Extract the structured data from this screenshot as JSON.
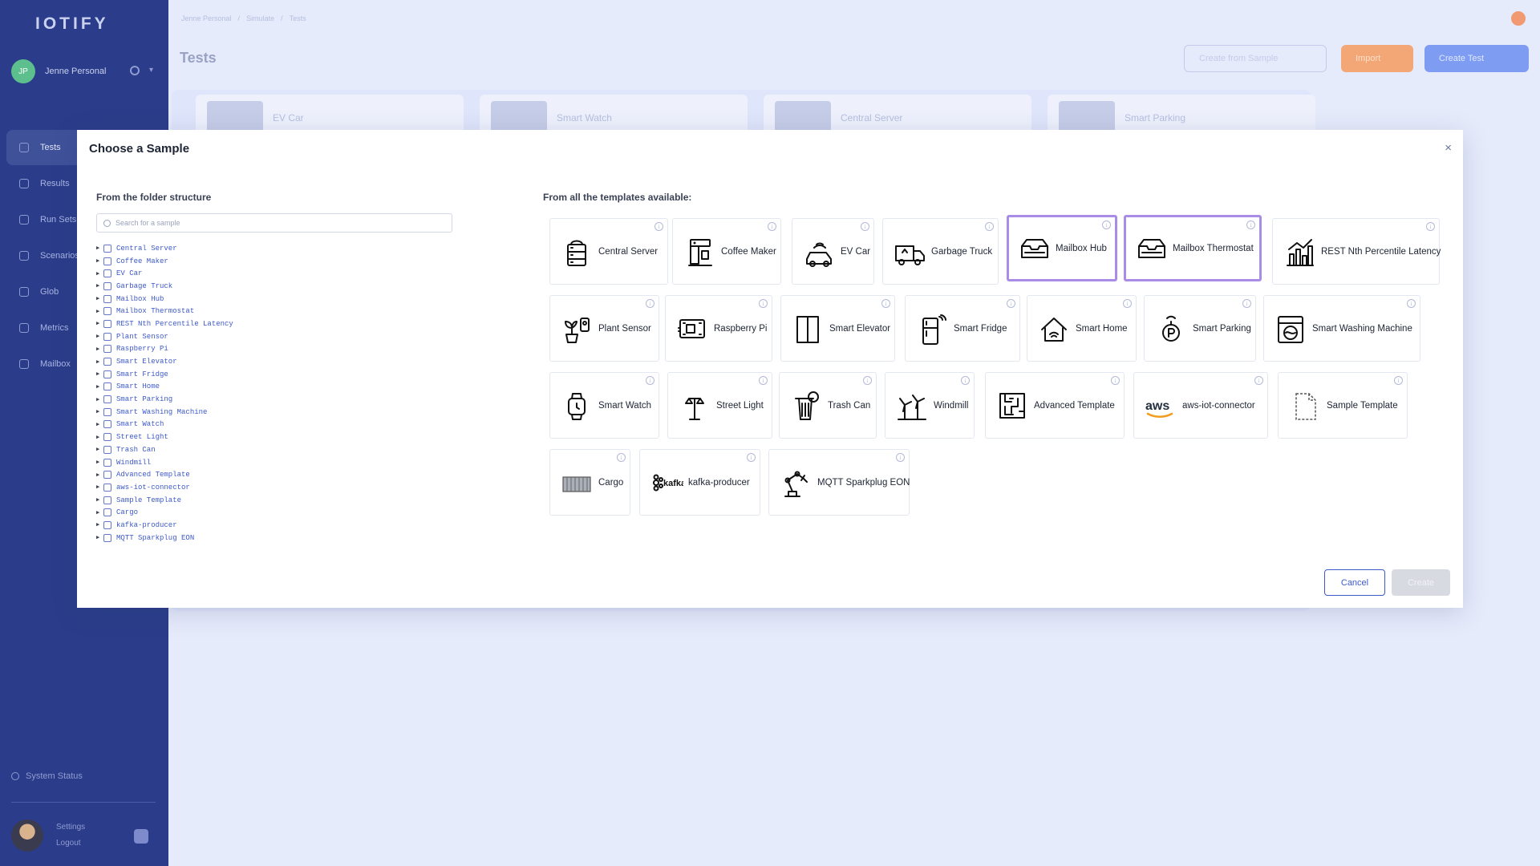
{
  "app": {
    "logo": "IOTIFY",
    "profile_name": "Jenne Personal",
    "profile_initials": "JP"
  },
  "sidebar": {
    "items": [
      {
        "label": "Tests",
        "active": true
      },
      {
        "label": "Results"
      },
      {
        "label": "Run Sets"
      },
      {
        "label": "Scenarios"
      },
      {
        "label": "Glob"
      },
      {
        "label": "Metrics"
      },
      {
        "label": "Mailbox"
      }
    ],
    "system_status": "System Status",
    "settings": "Settings",
    "logout": "Logout"
  },
  "header": {
    "breadcrumb": [
      "Jenne Personal",
      "Simulate",
      "Tests"
    ],
    "title": "Tests",
    "buttons": {
      "from_sample": "Create from Sample",
      "import": "Import",
      "create_test": "Create Test"
    }
  },
  "bg_cards": [
    "EV Car",
    "Smart Watch",
    "Central Server",
    "Smart Parking"
  ],
  "modal": {
    "title": "Choose a Sample",
    "close": "×",
    "left_label": "From the folder structure",
    "search_placeholder": "Search for a sample",
    "right_label": "From all the templates available:",
    "cancel": "Cancel",
    "create": "Create"
  },
  "tree": [
    "Central Server",
    "Coffee Maker",
    "EV Car",
    "Garbage Truck",
    "Mailbox Hub",
    "Mailbox Thermostat",
    "REST Nth Percentile Latency",
    "Plant Sensor",
    "Raspberry Pi",
    "Smart Elevator",
    "Smart Fridge",
    "Smart Home",
    "Smart Parking",
    "Smart Washing Machine",
    "Smart Watch",
    "Street Light",
    "Trash Can",
    "Windmill",
    "Advanced Template",
    "aws-iot-connector",
    "Sample Template",
    "Cargo",
    "kafka-producer",
    "MQTT Sparkplug EON"
  ],
  "templates": [
    {
      "name": "Central Server",
      "icon": "server-icon"
    },
    {
      "name": "Coffee Maker",
      "icon": "coffee-maker-icon"
    },
    {
      "name": "EV Car",
      "icon": "ev-car-icon"
    },
    {
      "name": "Garbage Truck",
      "icon": "garbage-truck-icon"
    },
    {
      "name": "Mailbox Hub",
      "icon": "mailbox-icon",
      "selected": true
    },
    {
      "name": "Mailbox Thermostat",
      "icon": "mailbox-icon",
      "selected": true
    },
    {
      "name": "REST Nth Percentile Latency",
      "icon": "bar-chart-icon"
    },
    {
      "name": "Plant Sensor",
      "icon": "plant-sensor-icon"
    },
    {
      "name": "Raspberry Pi",
      "icon": "circuit-board-icon"
    },
    {
      "name": "Smart Elevator",
      "icon": "elevator-icon"
    },
    {
      "name": "Smart Fridge",
      "icon": "fridge-icon"
    },
    {
      "name": "Smart Home",
      "icon": "home-icon"
    },
    {
      "name": "Smart Parking",
      "icon": "parking-icon"
    },
    {
      "name": "Smart Washing Machine",
      "icon": "washing-machine-icon"
    },
    {
      "name": "Smart Watch",
      "icon": "watch-icon"
    },
    {
      "name": "Street Light",
      "icon": "street-light-icon"
    },
    {
      "name": "Trash Can",
      "icon": "trash-can-icon"
    },
    {
      "name": "Windmill",
      "icon": "windmill-icon"
    },
    {
      "name": "Advanced Template",
      "icon": "maze-icon"
    },
    {
      "name": "aws-iot-connector",
      "icon": "aws-logo-icon",
      "logo_text": "aws"
    },
    {
      "name": "Sample Template",
      "icon": "document-icon"
    },
    {
      "name": "Cargo",
      "icon": "container-icon"
    },
    {
      "name": "kafka-producer",
      "icon": "kafka-logo-icon",
      "logo_text": "kafka"
    },
    {
      "name": "MQTT Sparkplug EON",
      "icon": "robot-arm-icon"
    }
  ],
  "colors": {
    "sidebar": "#2b3d8a",
    "accent": "#3d59c9",
    "selected_border": "#a98ce6",
    "import": "#f3a777",
    "create_test": "#7d9cf2"
  }
}
